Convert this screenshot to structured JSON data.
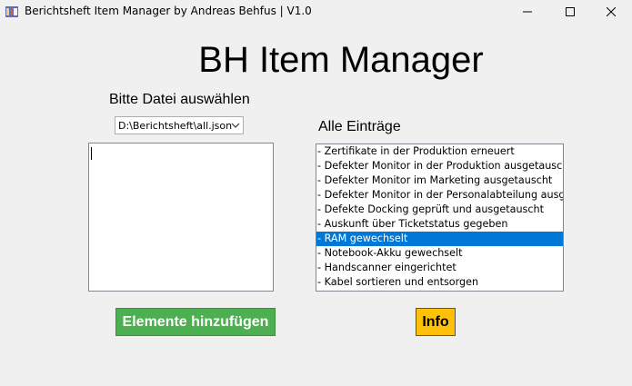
{
  "window": {
    "title": "Berichtsheft Item Manager by Andreas Behfus | V1.0",
    "minimize_icon": "minimize-icon",
    "maximize_icon": "maximize-icon",
    "close_icon": "close-icon"
  },
  "main": {
    "heading": "BH Item Manager",
    "file_label": "Bitte Datei auswählen",
    "entries_label": "Alle Einträge",
    "file_select": {
      "selected": "D:\\Berichtsheft\\all.json"
    },
    "input_text": "",
    "entries": [
      "- Zertifikate in der Produktion erneuert",
      "- Defekter Monitor in der Produktion ausgetauscht",
      "- Defekter Monitor im Marketing ausgetauscht",
      "- Defekter Monitor in der Personalabteilung ausgetauscht",
      "- Defekte Docking geprüft und ausgetauscht",
      "- Auskunft über Ticketstatus gegeben",
      "- RAM gewechselt",
      "- Notebook-Akku gewechselt",
      "- Handscanner eingerichtet",
      "- Kabel sortieren und entsorgen"
    ],
    "selected_entry": "- RAM gewechselt",
    "add_button": "Elemente hinzufügen",
    "info_button": "Info"
  },
  "colors": {
    "add_button": "#4caf50",
    "info_button": "#ffc107",
    "selection": "#0078d7"
  }
}
